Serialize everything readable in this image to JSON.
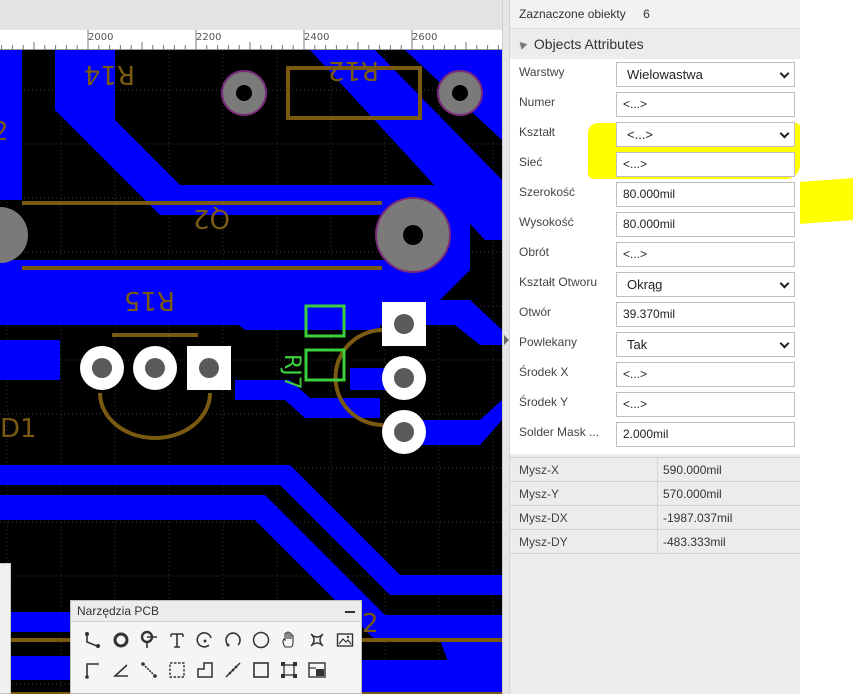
{
  "ruler": {
    "labels": [
      "2000",
      "2200",
      "2400",
      "2600"
    ]
  },
  "pcb": {
    "designators": [
      "R14",
      "R12",
      "Q2",
      "R15",
      "RJ7",
      "D1",
      "2",
      "2"
    ]
  },
  "panel": {
    "selected_label": "Zaznaczone obiekty",
    "selected_count": "6",
    "section_title": "Objects Attributes",
    "attributes": [
      {
        "label": "Warstwy",
        "value": "Wielowastwa",
        "type": "select"
      },
      {
        "label": "Numer",
        "value": "<...>",
        "type": "input"
      },
      {
        "label": "Kształt",
        "value": "<...>",
        "type": "select"
      },
      {
        "label": "Sieć",
        "value": "<...>",
        "type": "input"
      },
      {
        "label": "Szerokość",
        "value": "80.000mil",
        "type": "input"
      },
      {
        "label": "Wysokość",
        "value": "80.000mil",
        "type": "input"
      },
      {
        "label": "Obrót",
        "value": "<...>",
        "type": "input"
      },
      {
        "label": "Kształt Otworu",
        "value": "Okrąg",
        "type": "select"
      },
      {
        "label": "Otwór",
        "value": "39.370mil",
        "type": "input"
      },
      {
        "label": "Powlekany",
        "value": "Tak",
        "type": "select"
      },
      {
        "label": "Środek X",
        "value": "<...>",
        "type": "input"
      },
      {
        "label": "Środek Y",
        "value": "<...>",
        "type": "input"
      },
      {
        "label": "Solder Mask ...",
        "value": "2.000mil",
        "type": "input"
      }
    ],
    "mouse": [
      {
        "label": "Mysz-X",
        "value": "590.000mil"
      },
      {
        "label": "Mysz-Y",
        "value": "570.000mil"
      },
      {
        "label": "Mysz-DX",
        "value": "-1987.037mil"
      },
      {
        "label": "Mysz-DY",
        "value": "-483.333mil"
      }
    ]
  },
  "tools": {
    "title": "Narzędzia PCB",
    "row1": [
      "track-icon",
      "via-icon",
      "pad-icon",
      "text-icon",
      "arc-center-icon",
      "arc-edge-icon",
      "circle-icon",
      "pan-hand-icon",
      "pcb-footprint-icon",
      "image-icon"
    ],
    "row2": [
      "corner-line-icon",
      "angle-line-icon",
      "diagonal-line-icon",
      "dashed-rect-icon",
      "polygon-icon",
      "measure-icon",
      "rectangle-icon",
      "select-region-icon",
      "keepout-icon"
    ]
  },
  "colors": {
    "board": "#000000",
    "copper_top": "#0000ff",
    "silkscreen": "#7a5a10",
    "pad": "#ffffff",
    "highlight": "#ffff00",
    "grid": "#3a3a3a"
  }
}
